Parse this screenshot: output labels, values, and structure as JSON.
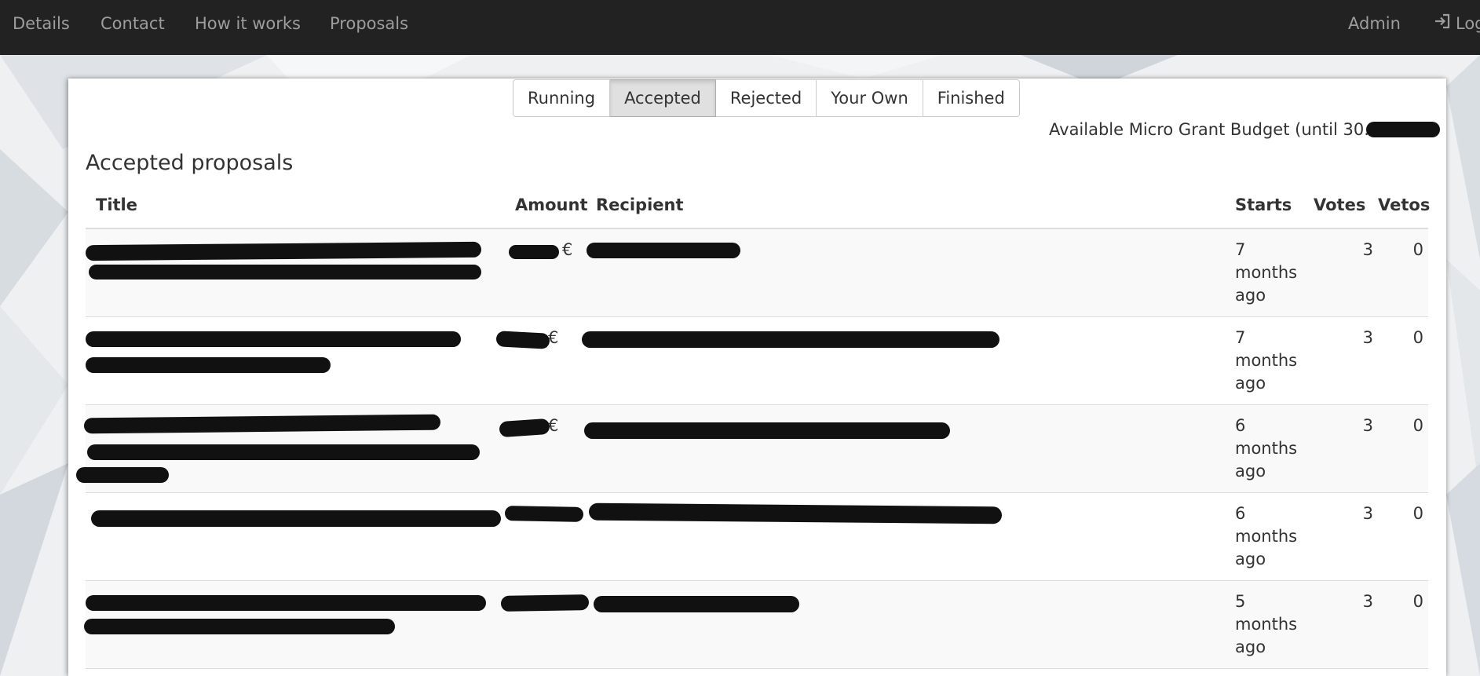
{
  "nav": {
    "items": [
      {
        "label": "Details"
      },
      {
        "label": "Contact"
      },
      {
        "label": "How it works"
      },
      {
        "label": "Proposals"
      }
    ],
    "admin_label": "Admin",
    "login_label": "Log",
    "login_icon": "sign-in-icon"
  },
  "filters": {
    "buttons": [
      {
        "label": "Running",
        "active": false
      },
      {
        "label": "Accepted",
        "active": true
      },
      {
        "label": "Rejected",
        "active": false
      },
      {
        "label": "Your Own",
        "active": false
      },
      {
        "label": "Finished",
        "active": false
      }
    ]
  },
  "budget": {
    "label": "Available Micro Grant Budget (until 30.9.):"
  },
  "section": {
    "title": "Accepted proposals"
  },
  "table": {
    "headers": {
      "title": "Title",
      "amount": "Amount",
      "recipient": "Recipient",
      "starts": "Starts",
      "votes": "Votes",
      "vetos": "Vetos"
    },
    "rows": [
      {
        "title": "",
        "amount": "€",
        "recipient": "",
        "starts": "7 months ago",
        "votes": "3",
        "vetos": "0"
      },
      {
        "title": "",
        "amount": "€",
        "recipient": "",
        "starts": "7 months ago",
        "votes": "3",
        "vetos": "0"
      },
      {
        "title": "",
        "amount": "€",
        "recipient": "",
        "starts": "6 months ago",
        "votes": "3",
        "vetos": "0"
      },
      {
        "title": "",
        "amount": "",
        "recipient": "",
        "starts": "6 months ago",
        "votes": "3",
        "vetos": "0"
      },
      {
        "title": "",
        "amount": "",
        "recipient": "",
        "starts": "5 months ago",
        "votes": "3",
        "vetos": "0"
      }
    ]
  },
  "colors": {
    "navbar": "#222222",
    "nav_text": "#9d9d9d",
    "link": "#337ab7",
    "redaction": "#111111",
    "active_button": "#e0e0e0"
  }
}
